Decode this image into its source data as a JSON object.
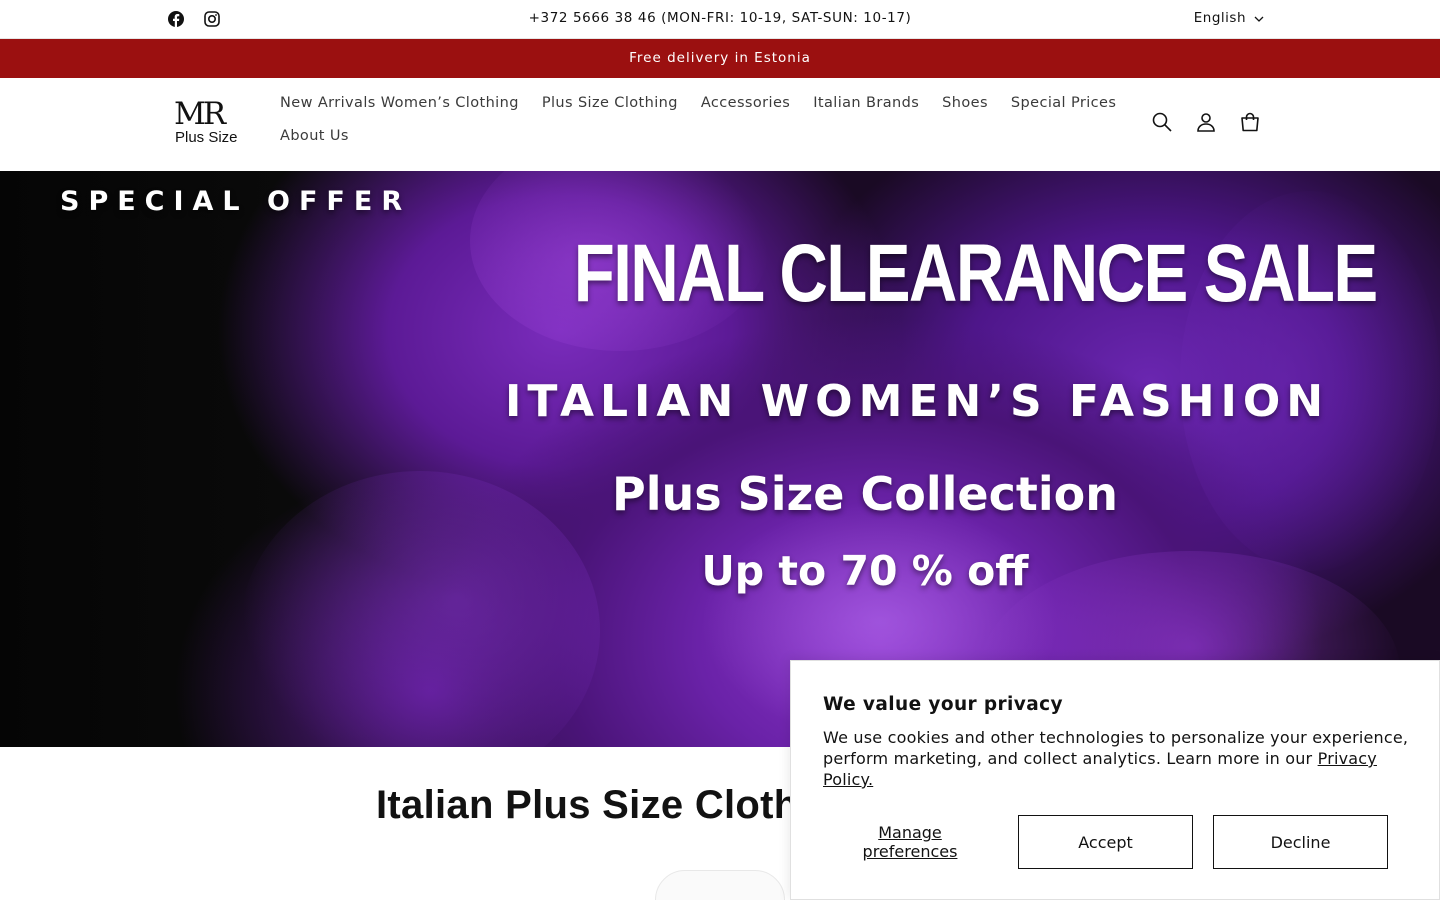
{
  "utility_bar": {
    "social_icons": [
      "facebook-icon",
      "instagram-icon"
    ],
    "phone": "+372 5666 38 46 (MON-FRI: 10-19, SAT-SUN: 10-17)",
    "language": "English"
  },
  "announcement": {
    "text": "Free delivery in Estonia"
  },
  "header": {
    "logo": {
      "main": "MR",
      "sub": "Plus Size"
    },
    "nav": [
      {
        "label": "New Arrivals Women’s Clothing"
      },
      {
        "label": "Plus Size Clothing"
      },
      {
        "label": "Accessories"
      },
      {
        "label": "Italian Brands"
      },
      {
        "label": "Shoes"
      },
      {
        "label": "Special Prices"
      },
      {
        "label": "About Us"
      }
    ],
    "icons": [
      "search-icon",
      "account-icon",
      "cart-icon"
    ]
  },
  "hero": {
    "eyebrow": "SPECIAL OFFER",
    "headline": "FINAL CLEARANCE SALE",
    "subheadline": "ITALIAN WOMEN’S FASHION",
    "collection": "Plus Size Collection",
    "discount": "Up to 70 % off"
  },
  "section": {
    "title": "Italian Plus Size Clothi"
  },
  "cookie_banner": {
    "title": "We value your privacy",
    "body": "We use cookies and other technologies to personalize your experience, perform marketing, and collect analytics. Learn more in our ",
    "link": "Privacy Policy.",
    "manage": "Manage preferences",
    "accept": "Accept",
    "decline": "Decline"
  },
  "colors": {
    "announcement_bg": "#9b1010",
    "hero_accent": "#7a2cbc",
    "text": "#121212"
  }
}
